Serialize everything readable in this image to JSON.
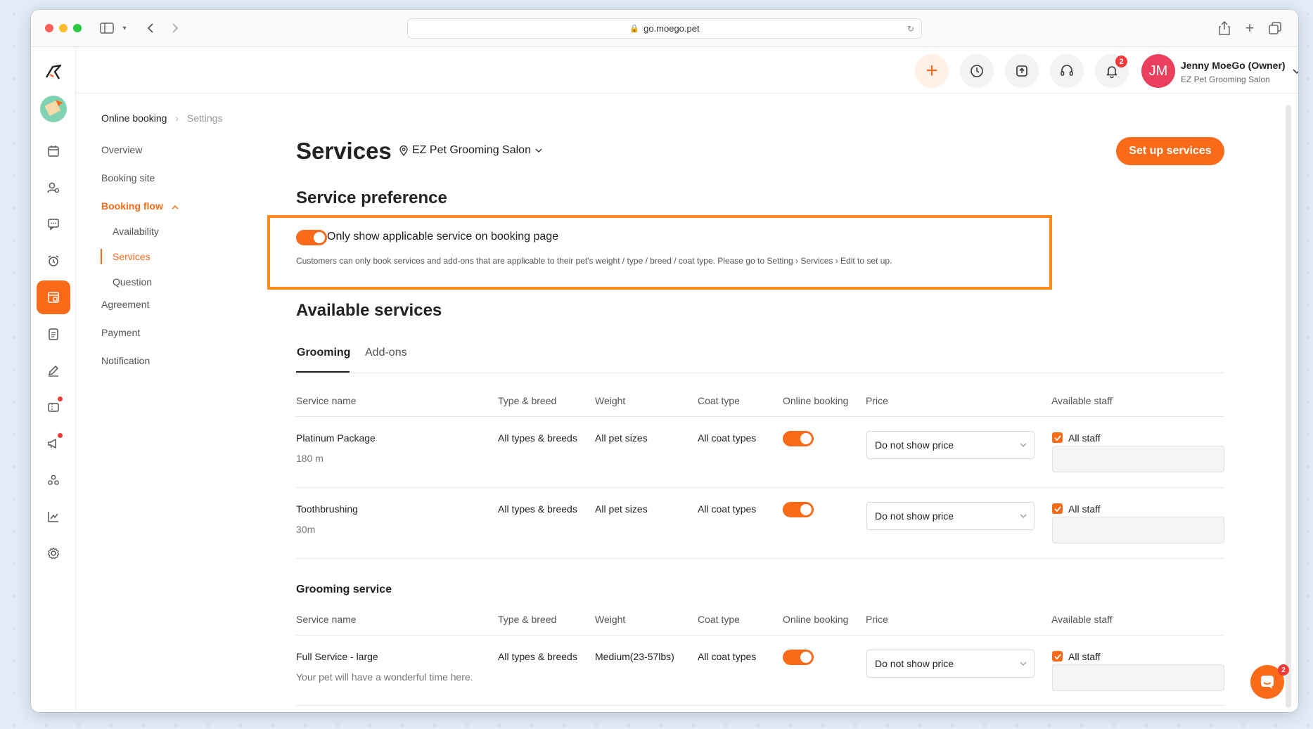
{
  "browser": {
    "url": "go.moego.pet"
  },
  "header": {
    "notification_count": "2",
    "user_initials": "JM",
    "user_name": "Jenny MoeGo (Owner)",
    "user_org": "EZ Pet Grooming Salon"
  },
  "breadcrumb": {
    "parent": "Online booking",
    "current": "Settings"
  },
  "subnav": {
    "overview": "Overview",
    "booking_site": "Booking site",
    "booking_flow": "Booking flow",
    "availability": "Availability",
    "services": "Services",
    "question": "Question",
    "agreement": "Agreement",
    "payment": "Payment",
    "notification": "Notification"
  },
  "main": {
    "title": "Services",
    "business": "EZ Pet Grooming Salon",
    "setup_button": "Set up services",
    "preference_heading": "Service preference",
    "preference_toggle_label": "Only show applicable service on booking page",
    "preference_desc": "Customers can only book services and add-ons that are applicable to their pet's weight / type / breed / coat type. Please go to Setting › Services › Edit to set up.",
    "available_heading": "Available services",
    "tabs": [
      "Grooming",
      "Add-ons"
    ],
    "columns": [
      "Service name",
      "Type & breed",
      "Weight",
      "Coat type",
      "Online booking",
      "Price",
      "Available staff"
    ],
    "rows": [
      {
        "name": "Platinum Package",
        "sub": "180 m",
        "type": "All types & breeds",
        "weight": "All pet sizes",
        "coat": "All coat types",
        "price": "Do not show price",
        "staff": "All staff"
      },
      {
        "name": "Toothbrushing",
        "sub": "30m",
        "type": "All types & breeds",
        "weight": "All pet sizes",
        "coat": "All coat types",
        "price": "Do not show price",
        "staff": "All staff"
      }
    ],
    "group_title": "Grooming service",
    "group_rows": [
      {
        "name": "Full Service - large",
        "sub": "Your pet will have a wonderful time here.",
        "type": "All types & breeds",
        "weight": "Medium(23-57lbs)",
        "coat": "All coat types",
        "price": "Do not show price",
        "staff": "All staff"
      }
    ]
  },
  "chat": {
    "badge": "2"
  },
  "colors": {
    "accent": "#f96b18",
    "highlight": "#ff8c1a",
    "avatar": "#ea3f5d",
    "badge": "#f03a3a"
  }
}
